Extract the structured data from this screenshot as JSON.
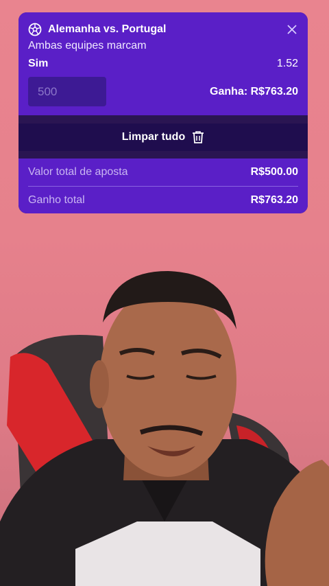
{
  "bet": {
    "match": "Alemanha vs. Portugal",
    "market": "Ambas equipes marcam",
    "selection": "Sim",
    "odds": "1.52",
    "stake_placeholder": "500",
    "potential_win": "Ganha: R$763.20",
    "sport_icon": "soccer-ball-icon",
    "close_icon": "close-icon"
  },
  "actions": {
    "clear_all": "Limpar tudo",
    "clear_icon": "trash-icon"
  },
  "totals": {
    "total_stake_label": "Valor total de aposta",
    "total_stake_value": "R$500.00",
    "total_win_label": "Ganho total",
    "total_win_value": "R$763.20"
  },
  "colors": {
    "card_purple": "#5a1fc7",
    "dark_bar": "#1f0d4e",
    "background_pink": "#e6818c"
  }
}
